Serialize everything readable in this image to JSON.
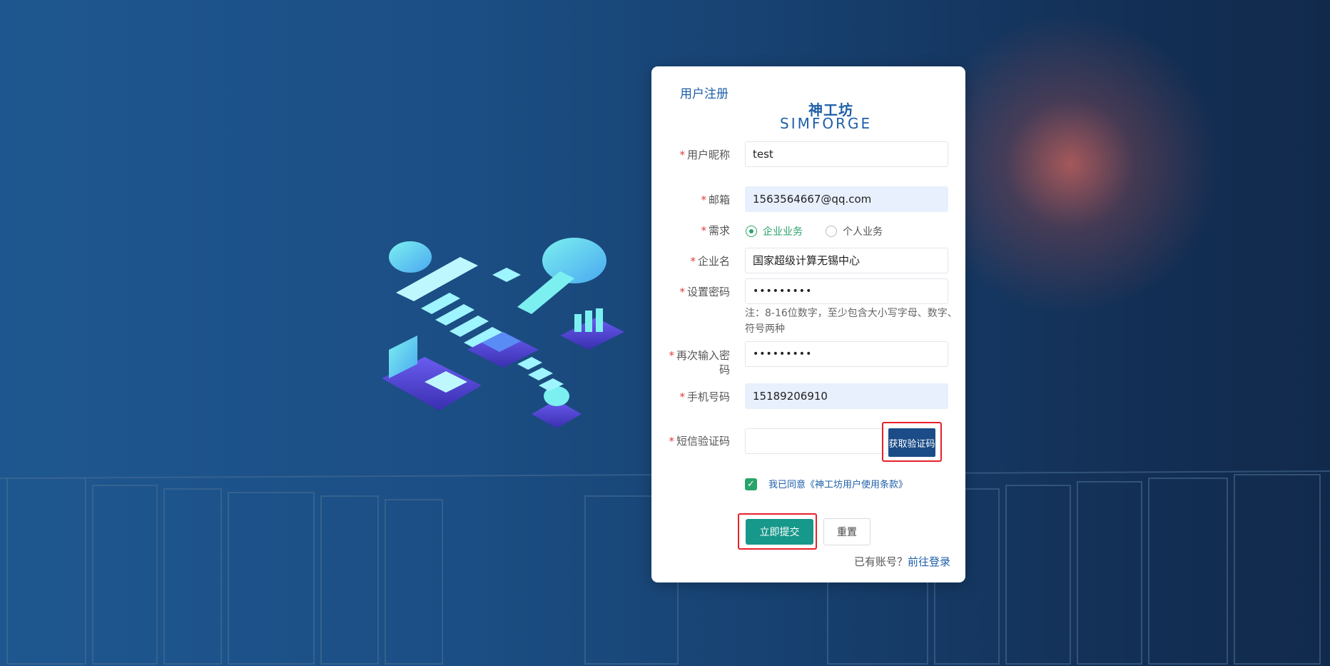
{
  "form": {
    "title": "用户注册",
    "logo_cn": "神工坊",
    "logo_en": "SIMFORGE",
    "required_mark": "*",
    "nickname": {
      "label": "用户昵称",
      "value": "test"
    },
    "email": {
      "label": "邮箱",
      "value": "1563564667@qq.com"
    },
    "need": {
      "label": "需求",
      "options": [
        "企业业务",
        "个人业务"
      ],
      "selected": "企业业务"
    },
    "company": {
      "label": "企业名",
      "value": "国家超级计算无锡中心"
    },
    "password": {
      "label": "设置密码",
      "value": "•••••••••",
      "hint": "注：8-16位数字，至少包含大小写字母、数字、符号两种"
    },
    "password_confirm": {
      "label": "再次输入密码",
      "value": "•••••••••"
    },
    "phone": {
      "label": "手机号码",
      "value": "15189206910"
    },
    "sms": {
      "label": "短信验证码",
      "value": "",
      "button": "获取验证码"
    },
    "agree_text": "我已同意《神工坊用户使用条款》",
    "submit_label": "立即提交",
    "reset_label": "重置",
    "has_account_text": "已有账号？",
    "login_link": "前往登录"
  },
  "colors": {
    "accent": "#1e5fa8",
    "submit": "#16988a",
    "sms_button": "#1b4c88",
    "highlight": "#e8202a",
    "radio_checked": "#2aa36a"
  }
}
